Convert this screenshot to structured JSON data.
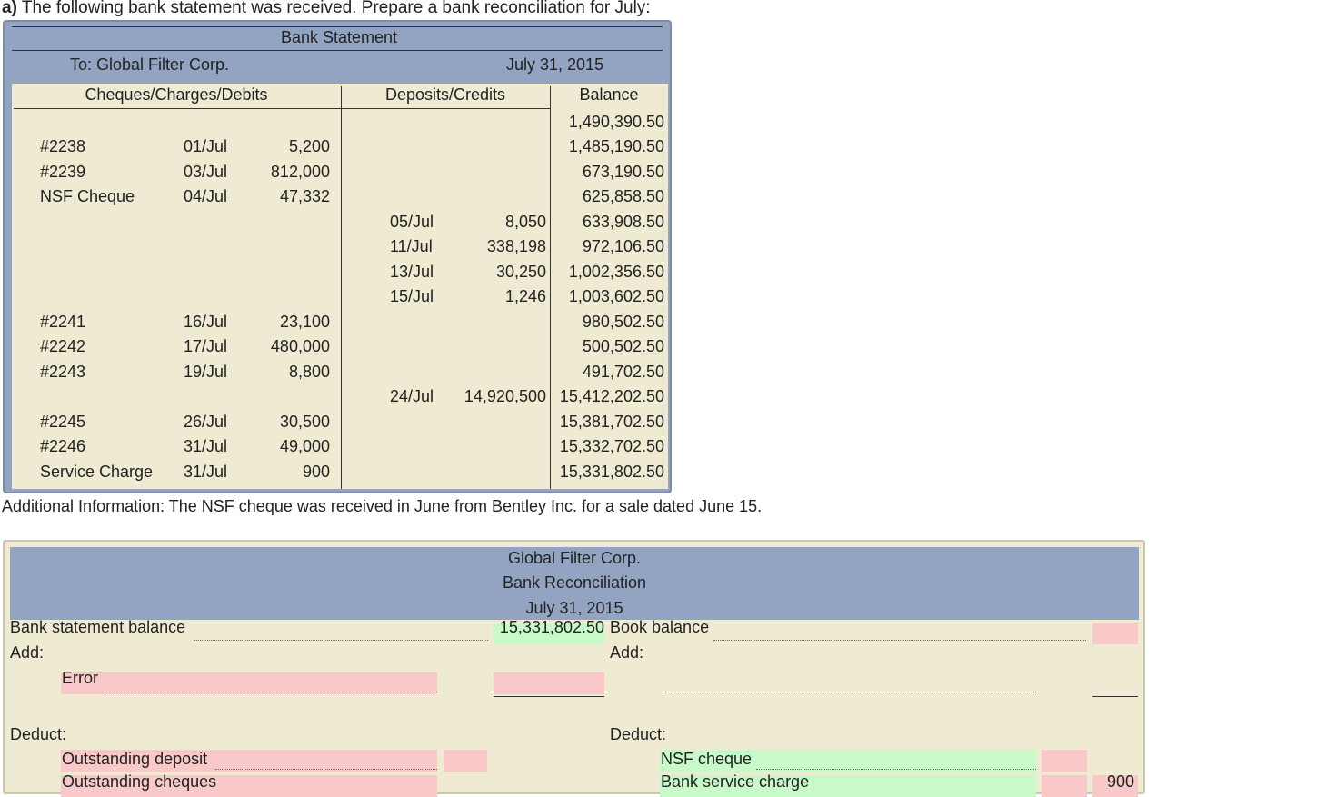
{
  "heading": {
    "part": "a)",
    "text": " The following bank statement was received. Prepare a bank reconciliation for July:"
  },
  "statement": {
    "title": "Bank Statement",
    "to": "To: Global Filter Corp.",
    "date": "July 31, 2015",
    "headers": {
      "debits": "Cheques/Charges/Debits",
      "credits": "Deposits/Credits",
      "balance": "Balance"
    },
    "opening_balance": "1,490,390.50",
    "rows": [
      {
        "desc": "#2238",
        "ddate": "01/Jul",
        "damt": "5,200",
        "cdate": "",
        "camt": "",
        "bal": "1,485,190.50"
      },
      {
        "desc": "#2239",
        "ddate": "03/Jul",
        "damt": "812,000",
        "cdate": "",
        "camt": "",
        "bal": "673,190.50"
      },
      {
        "desc": "NSF Cheque",
        "ddate": "04/Jul",
        "damt": "47,332",
        "cdate": "",
        "camt": "",
        "bal": "625,858.50"
      },
      {
        "desc": "",
        "ddate": "",
        "damt": "",
        "cdate": "05/Jul",
        "camt": "8,050",
        "bal": "633,908.50"
      },
      {
        "desc": "",
        "ddate": "",
        "damt": "",
        "cdate": "11/Jul",
        "camt": "338,198",
        "bal": "972,106.50"
      },
      {
        "desc": "",
        "ddate": "",
        "damt": "",
        "cdate": "13/Jul",
        "camt": "30,250",
        "bal": "1,002,356.50"
      },
      {
        "desc": "",
        "ddate": "",
        "damt": "",
        "cdate": "15/Jul",
        "camt": "1,246",
        "bal": "1,003,602.50"
      },
      {
        "desc": "#2241",
        "ddate": "16/Jul",
        "damt": "23,100",
        "cdate": "",
        "camt": "",
        "bal": "980,502.50"
      },
      {
        "desc": "#2242",
        "ddate": "17/Jul",
        "damt": "480,000",
        "cdate": "",
        "camt": "",
        "bal": "500,502.50"
      },
      {
        "desc": "#2243",
        "ddate": "19/Jul",
        "damt": "8,800",
        "cdate": "",
        "camt": "",
        "bal": "491,702.50"
      },
      {
        "desc": "",
        "ddate": "",
        "damt": "",
        "cdate": "24/Jul",
        "camt": "14,920,500",
        "bal": "15,412,202.50"
      },
      {
        "desc": "#2245",
        "ddate": "26/Jul",
        "damt": "30,500",
        "cdate": "",
        "camt": "",
        "bal": "15,381,702.50"
      },
      {
        "desc": "#2246",
        "ddate": "31/Jul",
        "damt": "49,000",
        "cdate": "",
        "camt": "",
        "bal": "15,332,702.50"
      },
      {
        "desc": "Service Charge",
        "ddate": "31/Jul",
        "damt": "900",
        "cdate": "",
        "camt": "",
        "bal": "15,331,802.50"
      }
    ]
  },
  "additional_info": "Additional Information: The NSF cheque was received in June from Bentley Inc. for a sale dated June 15.",
  "reconciliation": {
    "company": "Global Filter Corp.",
    "title": "Bank Reconciliation",
    "date": "July 31, 2015",
    "bank_balance_label": "Bank statement balance",
    "bank_balance_value": "15,331,802.50",
    "book_balance_label": "Book balance",
    "add_label": "Add:",
    "deduct_label": "Deduct:",
    "left_add_item": "Error",
    "left_deduct_item": "Outstanding deposit",
    "left_deduct_item2": "Outstanding cheques",
    "right_deduct_item": "NSF cheque",
    "right_deduct_item2": "Bank service charge",
    "right_deduct_value2": "900"
  }
}
